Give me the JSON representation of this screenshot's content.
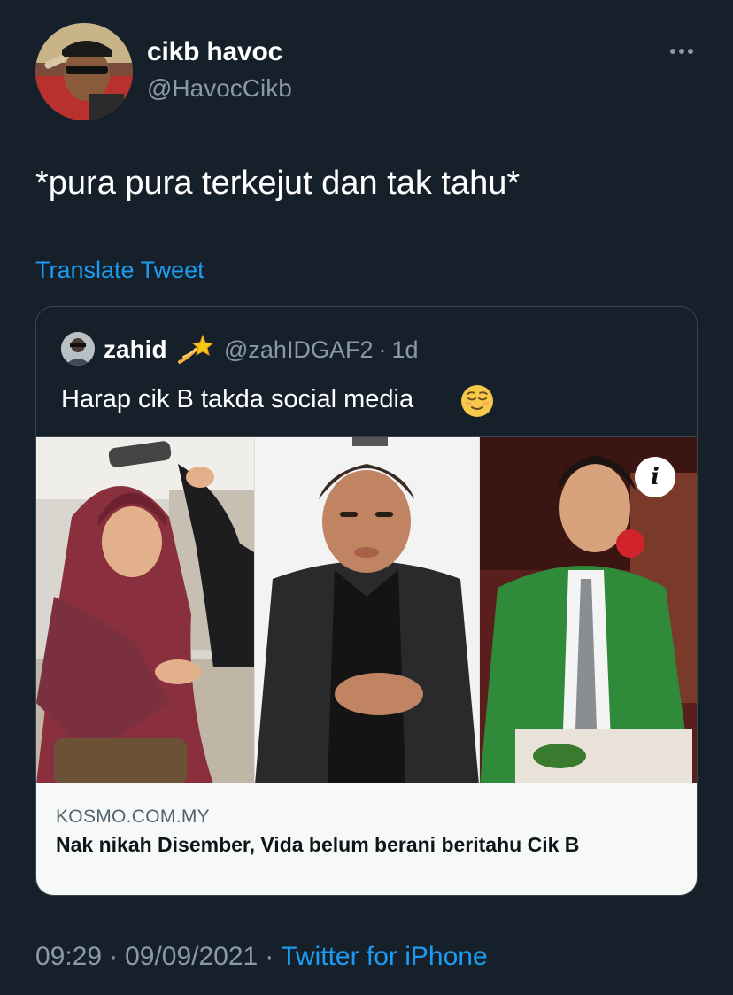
{
  "author": {
    "display_name": "cikb havoc",
    "handle": "@HavocCikb",
    "avatar_icon": "user-avatar"
  },
  "tweet": {
    "text": "*pura pura terkejut dan tak tahu*",
    "translate_label": "Translate Tweet",
    "more_icon": "more-options-icon"
  },
  "quoted_tweet": {
    "display_name": "zahid",
    "name_emoji": "dizzy-emoji",
    "handle": "@zahIDGAF2",
    "separator": "·",
    "time": "1d",
    "text": "Harap cik B takda social media",
    "text_emoji": "relieved-face-emoji",
    "link_card": {
      "domain": "KOSMO.COM.MY",
      "title": "Nak nikah Disember, Vida belum berani beritahu Cik B",
      "info_icon_label": "i"
    }
  },
  "footer": {
    "time": "09:29",
    "separator": "·",
    "date": "09/09/2021",
    "source": "Twitter for iPhone"
  },
  "colors": {
    "background": "#15202b",
    "primary_text": "#ffffff",
    "secondary_text": "#8b98a5",
    "link_blue": "#1d9bf0",
    "border": "#38444d",
    "card_background": "#f7f9f9"
  }
}
